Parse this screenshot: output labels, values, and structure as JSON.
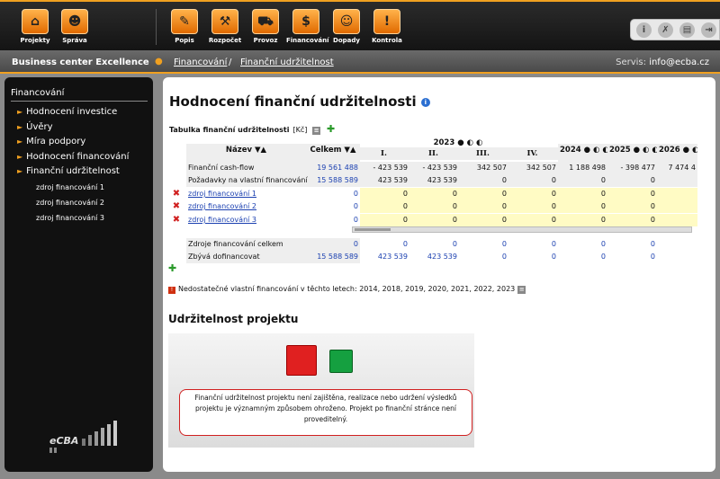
{
  "toolbar": {
    "left": [
      {
        "label": "Projekty",
        "icon": "home-icon",
        "glyph": "⌂"
      },
      {
        "label": "Správa",
        "icon": "user-icon",
        "glyph": "☻"
      }
    ],
    "right": [
      {
        "label": "Popis",
        "icon": "pencil-icon",
        "glyph": "✎"
      },
      {
        "label": "Rozpočet",
        "icon": "excavator-icon",
        "glyph": "⚒"
      },
      {
        "label": "Provoz",
        "icon": "car-icon",
        "glyph": "⛟"
      },
      {
        "label": "Financování",
        "icon": "piggy-bank-icon",
        "glyph": "$"
      },
      {
        "label": "Dopady",
        "icon": "people-icon",
        "glyph": "☺"
      },
      {
        "label": "Kontrola",
        "icon": "warning-icon",
        "glyph": "!"
      }
    ],
    "tools": [
      {
        "icon": "info-icon",
        "glyph": "i"
      },
      {
        "icon": "wrench-icon",
        "glyph": "✗"
      },
      {
        "icon": "printer-icon",
        "glyph": "▤"
      },
      {
        "icon": "exit-icon",
        "glyph": "⇥"
      }
    ]
  },
  "subheader": {
    "brand": "Business center Excellence",
    "crumb1": "Financování",
    "sep": "/",
    "crumb2": "Finanční udržitelnost",
    "servis_label": "Servis:",
    "servis_email": "info@ecba.cz"
  },
  "sidebar": {
    "heading": "Financování",
    "items": [
      "Hodnocení investice",
      "Úvěry",
      "Míra podpory",
      "Hodnocení financování",
      "Finanční udržitelnost"
    ],
    "subitems": [
      "zdroj financování 1",
      "zdroj financování 2",
      "zdroj financování 3"
    ],
    "logo_text": "eCBA"
  },
  "main": {
    "title": "Hodnocení finanční udržitelnosti",
    "table_label": "Tabulka finanční udržitelnosti",
    "currency": "[Kč]",
    "headers": {
      "name": "Název",
      "total": "Celkem",
      "y2023": "2023",
      "quarters": [
        "I.",
        "II.",
        "III.",
        "IV."
      ],
      "years": [
        "2024",
        "2025",
        "2026"
      ]
    },
    "rows": [
      {
        "name": "Finanční cash-flow",
        "link": false,
        "del": false,
        "total": "19 561 488",
        "vals": [
          "- 423 539",
          "- 423 539",
          "342 507",
          "342 507",
          "1 188 498",
          "- 398 477",
          "7 474 4"
        ]
      },
      {
        "name": "Požadavky na vlastní financování",
        "link": false,
        "del": false,
        "total": "15 588 589",
        "vals": [
          "423 539",
          "423 539",
          "0",
          "0",
          "0",
          "0",
          ""
        ]
      },
      {
        "name": "zdroj financování 1",
        "link": true,
        "del": true,
        "total": "0",
        "vals": [
          "0",
          "0",
          "0",
          "0",
          "0",
          "0",
          ""
        ]
      },
      {
        "name": "zdroj financování 2",
        "link": true,
        "del": true,
        "total": "0",
        "vals": [
          "0",
          "0",
          "0",
          "0",
          "0",
          "0",
          ""
        ]
      },
      {
        "name": "zdroj financování 3",
        "link": true,
        "del": true,
        "total": "0",
        "vals": [
          "0",
          "0",
          "0",
          "0",
          "0",
          "0",
          ""
        ]
      },
      {
        "name": "Zdroje financování celkem",
        "link": false,
        "del": false,
        "total": "0",
        "vals": [
          "0",
          "0",
          "0",
          "0",
          "0",
          "0",
          ""
        ]
      },
      {
        "name": "Zbývá dofinancovat",
        "link": false,
        "del": false,
        "total": "15 588 589",
        "vals": [
          "423 539",
          "423 539",
          "0",
          "0",
          "0",
          "0",
          ""
        ]
      }
    ],
    "warning": "Nedostatečné vlastní financování v těchto letech: 2014, 2018, 2019, 2020, 2021, 2022, 2023",
    "section_title": "Udržitelnost projektu",
    "message": "Finanční udržitelnost projektu není zajištěna, realizace nebo udržení výsledků projektu je významným způsobem ohroženo. Projekt po finanční stránce není proveditelný.",
    "colors": {
      "red": "#e02020",
      "green": "#15a040",
      "accent": "#f0a020"
    }
  }
}
